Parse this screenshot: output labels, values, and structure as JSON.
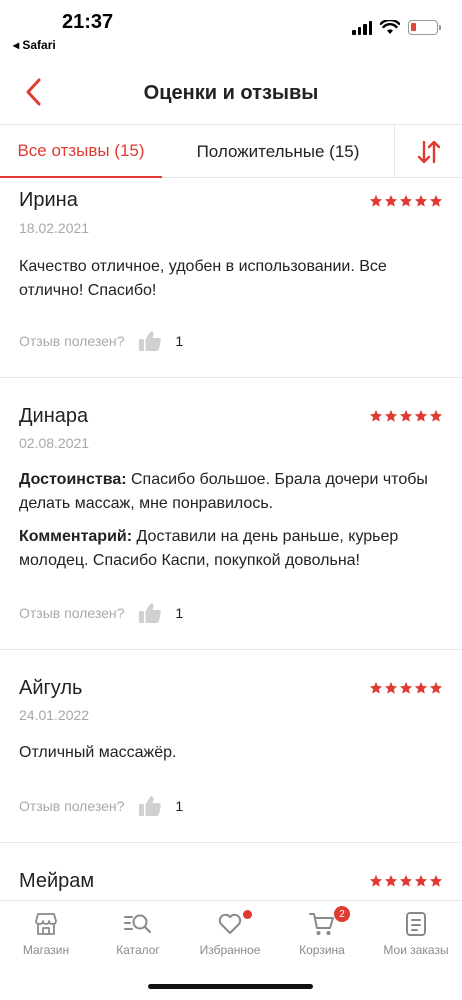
{
  "status_bar": {
    "time": "21:37",
    "back_app": "◂ Safari",
    "battery_level": 0.2,
    "battery_color": "#e5453b"
  },
  "header": {
    "title": "Оценки и отзывы",
    "back_icon": "chevron-left-icon"
  },
  "tabs": {
    "all": "Все отзывы (15)",
    "positive": "Положительные (15)",
    "sort_icon": "sort-arrows-icon"
  },
  "helpful_label": "Отзыв полезен?",
  "reviews": [
    {
      "name": "Ирина",
      "date": "18.02.2021",
      "rating": 5,
      "text": "Качество отличное, удобен в использовании. Все отлично! Спасибо!",
      "helpful_count": "1"
    },
    {
      "name": "Динара",
      "date": "02.08.2021",
      "rating": 5,
      "pros_label": "Достоинства:",
      "pros_text": " Спасибо большое. Брала дочери чтобы делать массаж, мне понравилось.",
      "comment_label": "Комментарий:",
      "comment_text": " Доставили на день раньше, курьер молодец. Спасибо Каспи, покупкой довольна!",
      "helpful_count": "1"
    },
    {
      "name": "Айгуль",
      "date": "24.01.2022",
      "rating": 5,
      "text": "Отличный массажёр.",
      "helpful_count": "1"
    },
    {
      "name": "Мейрам",
      "rating": 5
    }
  ],
  "bottom_nav": {
    "items": [
      {
        "label": "Магазин",
        "icon": "store-icon"
      },
      {
        "label": "Каталог",
        "icon": "catalog-search-icon"
      },
      {
        "label": "Избранное",
        "icon": "heart-icon"
      },
      {
        "label": "Корзина",
        "icon": "cart-icon",
        "badge": "2"
      },
      {
        "label": "Мои заказы",
        "icon": "orders-icon"
      }
    ]
  },
  "colors": {
    "accent": "#e03b31",
    "muted_text": "#a8a8a8",
    "star": "#e03b31"
  }
}
